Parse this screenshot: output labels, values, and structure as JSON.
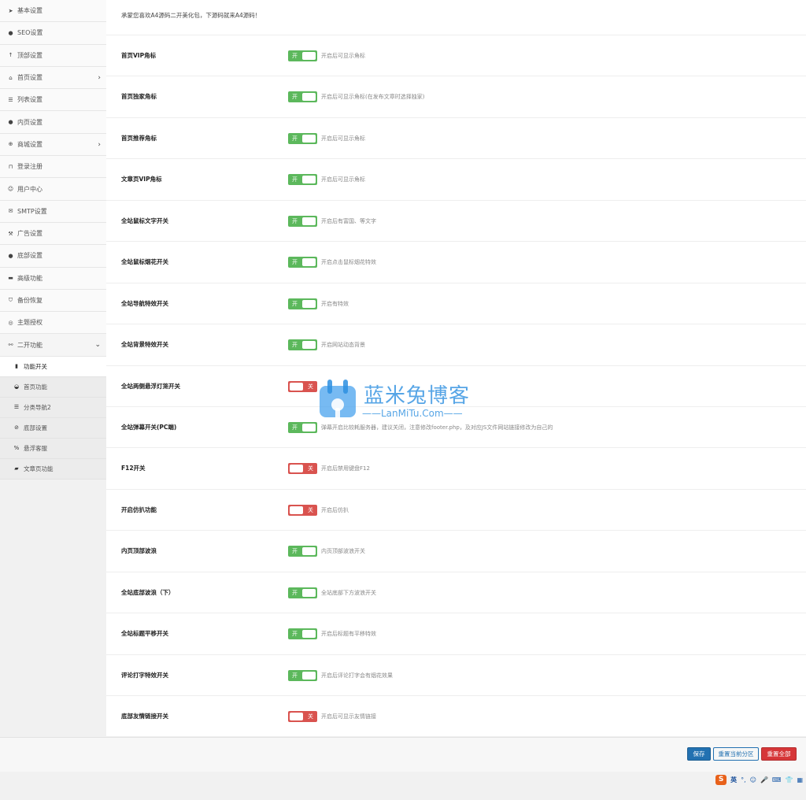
{
  "sidebar": {
    "items": [
      {
        "label": "基本设置",
        "icon": "paper-plane-icon",
        "glyph": "➤"
      },
      {
        "label": "SEO设置",
        "icon": "circle-icon",
        "glyph": "●"
      },
      {
        "label": "顶部设置",
        "icon": "arrow-up-icon",
        "glyph": "↑"
      },
      {
        "label": "首页设置",
        "icon": "home-icon",
        "glyph": "⌂",
        "chevron": "›"
      },
      {
        "label": "列表设置",
        "icon": "list-icon",
        "glyph": "☰"
      },
      {
        "label": "内页设置",
        "icon": "circle-icon",
        "glyph": "●"
      },
      {
        "label": "商城设置",
        "icon": "plus-circle-icon",
        "glyph": "⊕",
        "chevron": "›"
      },
      {
        "label": "登录注册",
        "icon": "lock-icon",
        "glyph": "⊓"
      },
      {
        "label": "用户中心",
        "icon": "user-icon",
        "glyph": "☺"
      },
      {
        "label": "SMTP设置",
        "icon": "envelope-icon",
        "glyph": "✉"
      },
      {
        "label": "广告设置",
        "icon": "gavel-icon",
        "glyph": "⚒"
      },
      {
        "label": "底部设置",
        "icon": "circle-icon",
        "glyph": "●"
      },
      {
        "label": "高级功能",
        "icon": "window-icon",
        "glyph": "▬"
      },
      {
        "label": "备份恢复",
        "icon": "shield-icon",
        "glyph": "⛉"
      },
      {
        "label": "主题授权",
        "icon": "eye-icon",
        "glyph": "◎"
      },
      {
        "label": "二开功能",
        "icon": "link-icon",
        "glyph": "⚯",
        "chevron": "⌄"
      }
    ],
    "subitems": [
      {
        "label": "功能开关",
        "icon": "lock-icon",
        "glyph": "▮",
        "active": true
      },
      {
        "label": "首页功能",
        "icon": "dashboard-icon",
        "glyph": "◒"
      },
      {
        "label": "分类导航2",
        "icon": "list-icon",
        "glyph": "☰"
      },
      {
        "label": "底部设置",
        "icon": "globe-icon",
        "glyph": "⊘"
      },
      {
        "label": "悬浮客服",
        "icon": "link-icon",
        "glyph": "%"
      },
      {
        "label": "文章页功能",
        "icon": "book-icon",
        "glyph": "▰"
      }
    ]
  },
  "notice": "承蒙您喜欢A4源码二开美化包，下源码就来A4源码！",
  "settings": [
    {
      "label": "首页VIP角标",
      "state": "开",
      "on": true,
      "desc": "开启后可显示角标"
    },
    {
      "label": "首页独家角标",
      "state": "开",
      "on": true,
      "desc": "开启后可显示角标(在发布文章时选择独家)"
    },
    {
      "label": "首页推荐角标",
      "state": "开",
      "on": true,
      "desc": "开启后可显示角标"
    },
    {
      "label": "文章页VIP角标",
      "state": "开",
      "on": true,
      "desc": "开启后可显示角标"
    },
    {
      "label": "全站鼠标文字开关",
      "state": "开",
      "on": true,
      "desc": "开启后有富国、等文字"
    },
    {
      "label": "全站鼠标烟花开关",
      "state": "开",
      "on": true,
      "desc": "开启点击鼠标烟花特效"
    },
    {
      "label": "全站导航特效开关",
      "state": "开",
      "on": true,
      "desc": "开启有特效"
    },
    {
      "label": "全站背景特效开关",
      "state": "开",
      "on": true,
      "desc": "开启网站动态背景"
    },
    {
      "label": "全站两侧悬浮灯笼开关",
      "state": "关",
      "on": false,
      "desc": ""
    },
    {
      "label": "全站弹幕开关(PC端)",
      "state": "开",
      "on": true,
      "desc": "弹幕开启比较耗服务器，建议关闭，注意修改footer.php，及对应JS文件网站链接修改为自己的"
    },
    {
      "label": "F12开关",
      "state": "关",
      "on": false,
      "desc": "开启后禁用键盘F12"
    },
    {
      "label": "开启仿扒功能",
      "state": "关",
      "on": false,
      "desc": "开启后仿扒"
    },
    {
      "label": "内页顶部波浪",
      "state": "开",
      "on": true,
      "desc": "内页顶部波浪开关"
    },
    {
      "label": "全站底部波浪（下）",
      "state": "开",
      "on": true,
      "desc": "全站底部下方波浪开关"
    },
    {
      "label": "全站标题平移开关",
      "state": "开",
      "on": true,
      "desc": "开启后标题有平移特效"
    },
    {
      "label": "评论打字特效开关",
      "state": "开",
      "on": true,
      "desc": "开启后评论打字会有烟花效果"
    },
    {
      "label": "底部友情链接开关",
      "state": "关",
      "on": false,
      "desc": "开启后可显示友情链接"
    }
  ],
  "footer": {
    "save": "保存",
    "reset_section": "重置当前分区",
    "reset_all": "重置全部"
  },
  "watermark": {
    "title": "蓝米兔博客",
    "subtitle": "——LanMiTu.Com——"
  },
  "ime": {
    "logo": "S",
    "lang": "英",
    "punct": "°,",
    "icons": [
      "☺",
      "🎤",
      "⌨",
      "👕",
      "▦"
    ]
  },
  "colors": {
    "toggle_on": "#5cb85c",
    "toggle_off": "#d9534f",
    "save_button": "#2271b1",
    "reset_all_button": "#d63638"
  }
}
